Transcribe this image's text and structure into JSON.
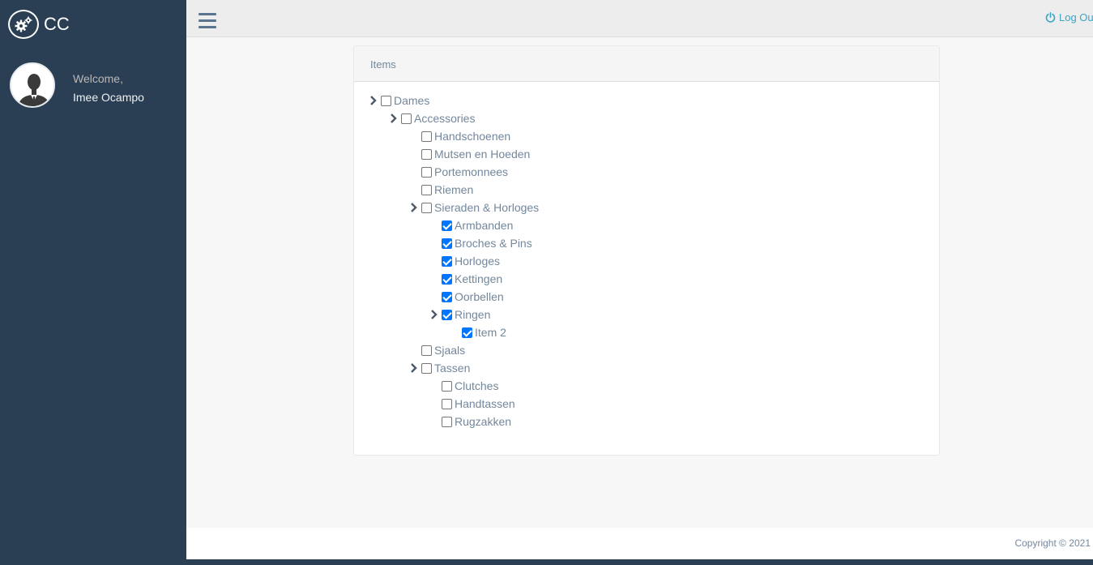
{
  "sidebar": {
    "brand": "CC",
    "brand_icon": "gears-icon",
    "welcome": "Welcome,",
    "username": "Imee Ocampo"
  },
  "topnav": {
    "menu_icon": "hamburger-icon",
    "logout_label": "Log Out",
    "logout_icon": "power-icon"
  },
  "panel": {
    "title": "Items"
  },
  "tree": [
    {
      "label": "Dames",
      "depth": 0,
      "checked": false,
      "expandable": true
    },
    {
      "label": "Accessories",
      "depth": 1,
      "checked": false,
      "expandable": true
    },
    {
      "label": "Handschoenen",
      "depth": 2,
      "checked": false,
      "expandable": false
    },
    {
      "label": "Mutsen en Hoeden",
      "depth": 2,
      "checked": false,
      "expandable": false
    },
    {
      "label": "Portemonnees",
      "depth": 2,
      "checked": false,
      "expandable": false
    },
    {
      "label": "Riemen",
      "depth": 2,
      "checked": false,
      "expandable": false
    },
    {
      "label": "Sieraden & Horloges",
      "depth": 2,
      "checked": false,
      "expandable": true
    },
    {
      "label": "Armbanden",
      "depth": 3,
      "checked": true,
      "expandable": false
    },
    {
      "label": "Broches & Pins",
      "depth": 3,
      "checked": true,
      "expandable": false
    },
    {
      "label": "Horloges",
      "depth": 3,
      "checked": true,
      "expandable": false
    },
    {
      "label": "Kettingen",
      "depth": 3,
      "checked": true,
      "expandable": false
    },
    {
      "label": "Oorbellen",
      "depth": 3,
      "checked": true,
      "expandable": false
    },
    {
      "label": "Ringen",
      "depth": 3,
      "checked": true,
      "expandable": true
    },
    {
      "label": "Item 2",
      "depth": 4,
      "checked": true,
      "expandable": false
    },
    {
      "label": "Sjaals",
      "depth": 2,
      "checked": false,
      "expandable": false
    },
    {
      "label": "Tassen",
      "depth": 2,
      "checked": false,
      "expandable": true
    },
    {
      "label": "Clutches",
      "depth": 3,
      "checked": false,
      "expandable": false
    },
    {
      "label": "Handtassen",
      "depth": 3,
      "checked": false,
      "expandable": false
    },
    {
      "label": "Rugzakken",
      "depth": 3,
      "checked": false,
      "expandable": false
    }
  ],
  "footer": {
    "copyright": "Copyright © 2021"
  },
  "colors": {
    "sidebar_bg": "#2a3f54",
    "accent": "#3ca4c9",
    "text_muted": "#73879c",
    "checkbox_checked": "#0075ff"
  }
}
